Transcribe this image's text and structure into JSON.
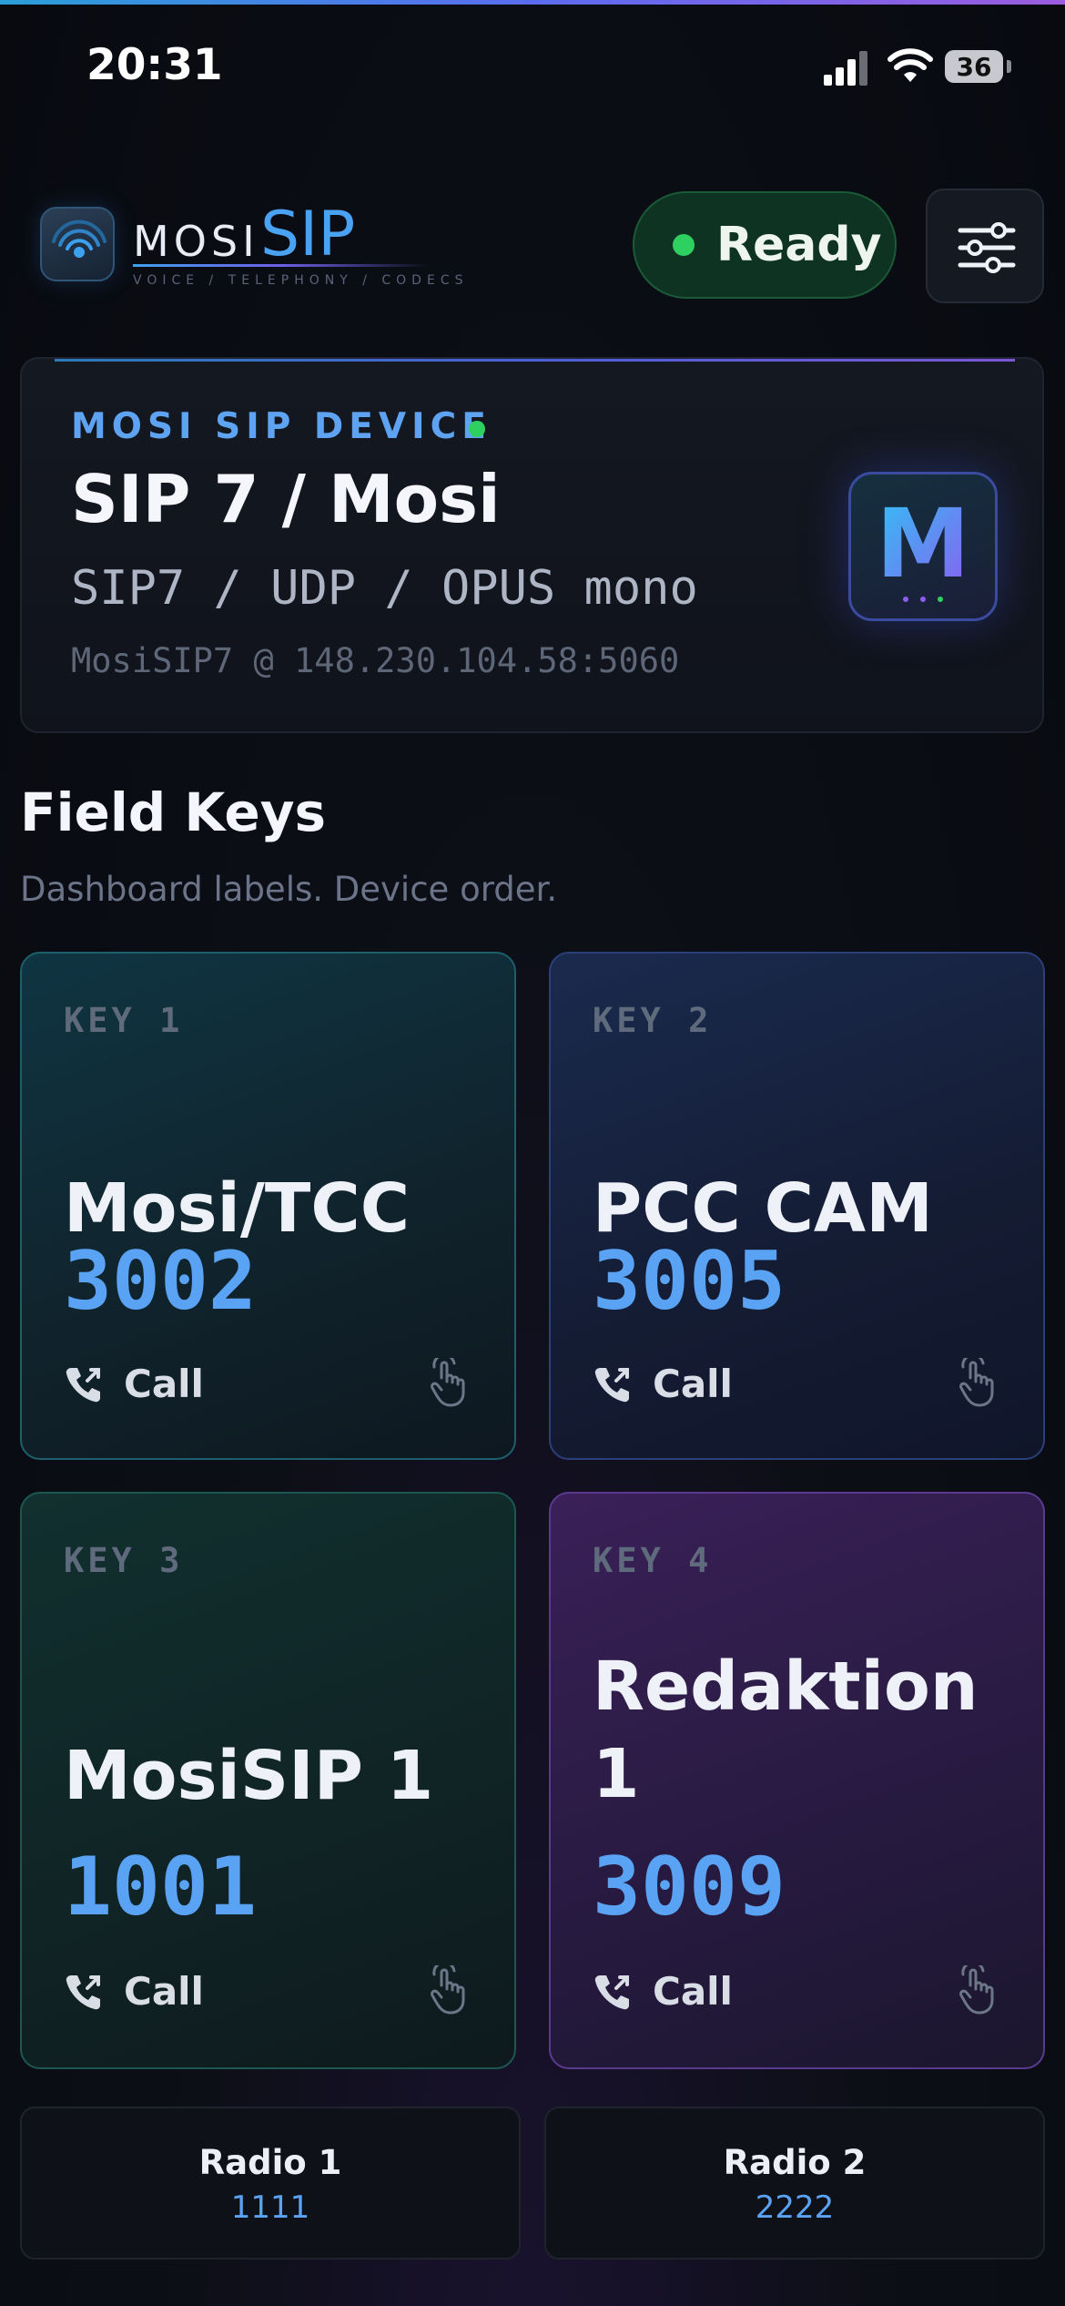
{
  "status_bar": {
    "time": "20:31",
    "battery": "36"
  },
  "header": {
    "brand_prefix": "MOSI",
    "brand_main": "SIP",
    "tagline": "VOICE / TELEPHONY / CODECS",
    "status_label": "Ready",
    "status_color": "#2ed060"
  },
  "device": {
    "eyebrow": "MOSI SIP DEVICE",
    "title": "SIP 7 / Mosi",
    "protocol": "SIP7 / UDP / OPUS mono",
    "address": "MosiSIP7 @ 148.230.104.58:5060",
    "avatar_letter": "M"
  },
  "section": {
    "title": "Field Keys",
    "subtitle": "Dashboard labels. Device order."
  },
  "keys": [
    {
      "label": "KEY 1",
      "name": "Mosi/TCC",
      "number": "3002",
      "action": "Call"
    },
    {
      "label": "KEY 2",
      "name": "PCC CAM",
      "number": "3005",
      "action": "Call"
    },
    {
      "label": "KEY 3",
      "name": "MosiSIP 1",
      "number": "1001",
      "action": "Call"
    },
    {
      "label": "KEY 4",
      "name": "Redaktion 1",
      "number": "3009",
      "action": "Call"
    }
  ],
  "bottom": [
    {
      "name": "Radio 1",
      "number": "1111"
    },
    {
      "name": "Radio 2",
      "number": "2222"
    }
  ],
  "colors": {
    "accent_blue": "#5aa3f4",
    "ready_green": "#2ed060",
    "key4_purple": "#5a3a8e"
  },
  "icons": [
    "cellular-signal-icon",
    "wifi-icon",
    "battery-icon",
    "signal-waves-icon",
    "sliders-icon",
    "phone-outgoing-icon",
    "tap-hand-icon"
  ]
}
